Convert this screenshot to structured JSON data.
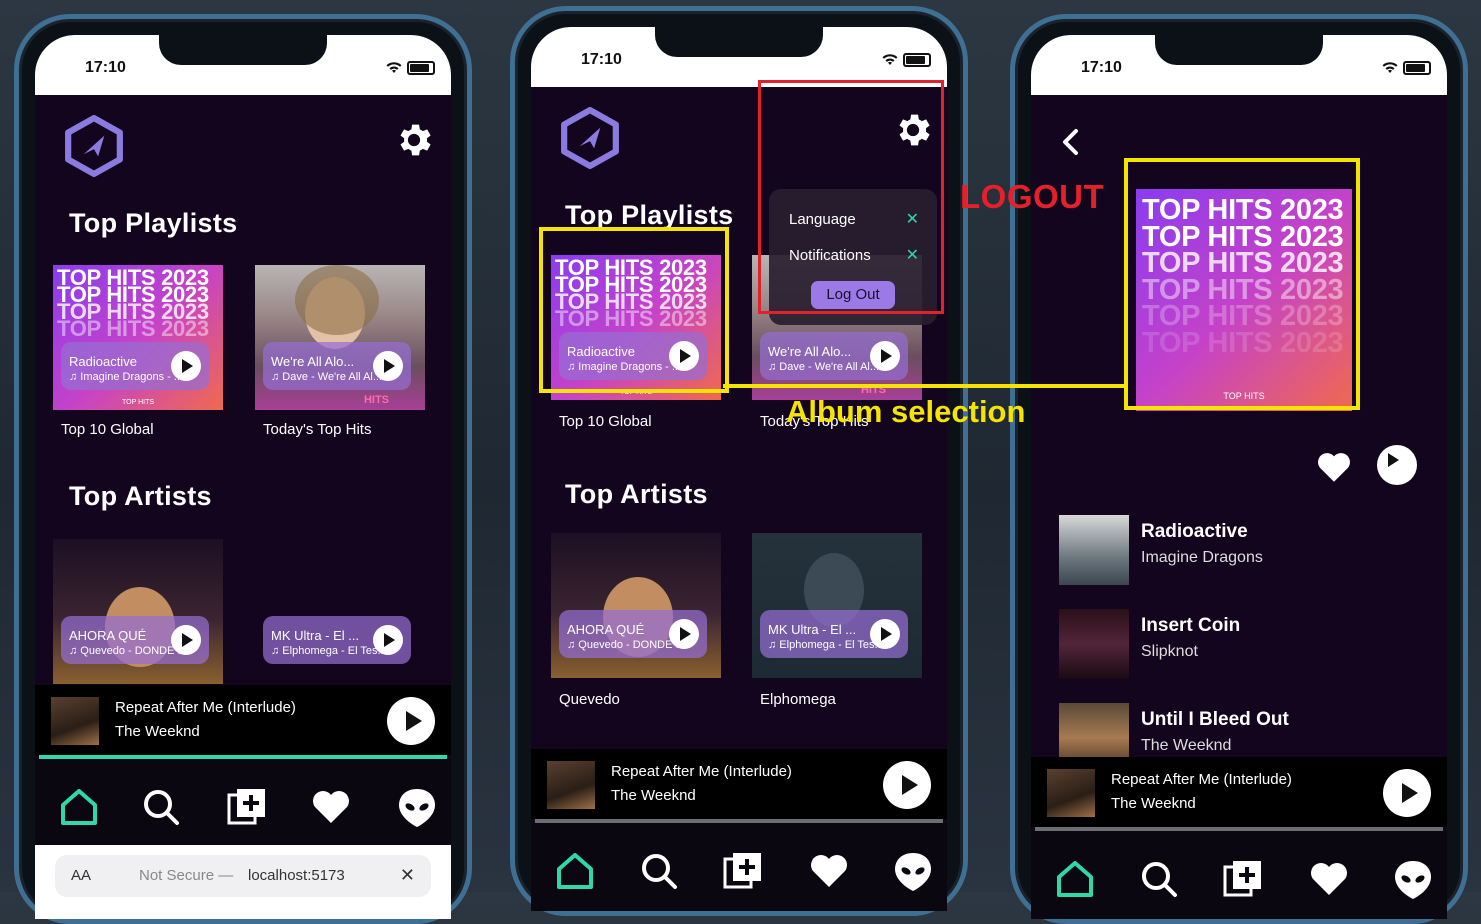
{
  "phones": [
    {
      "time": "17:10",
      "heading_playlists": "Top Playlists",
      "heading_artists": "Top Artists",
      "playlists": [
        {
          "cover_text": "TOP HITS 2023",
          "badge": "TOP HITS",
          "track": "Radioactive",
          "artist": "♫ Imagine Dragons - ...",
          "caption": "Top 10 Global"
        },
        {
          "track": "We're All Alo...",
          "artist": "♫ Dave - We're All Al...",
          "caption": "Today's Top Hits",
          "cover_word": "HITS"
        }
      ],
      "artists": [
        {
          "track": "AHORA QUÉ",
          "artist": "♫ Quevedo - DONDE ...",
          "caption": ""
        },
        {
          "track": "MK Ultra - El ...",
          "artist": "♫ Elphomega - El Tes...",
          "caption": ""
        }
      ],
      "now_playing": {
        "title": "Repeat After Me (Interlude)",
        "artist": "The Weeknd",
        "progress": 1.0
      },
      "safari": {
        "aa": "AA",
        "not_secure": "Not Secure —",
        "url": "localhost:5173",
        "close": "✕"
      }
    },
    {
      "time": "17:10",
      "heading_playlists": "Top Playlists",
      "heading_artists": "Top Artists",
      "menu": {
        "language": "Language",
        "notifications": "Notifications",
        "logout": "Log Out"
      },
      "playlists": [
        {
          "cover_text": "TOP HITS 2023",
          "badge": "TOP HITS",
          "track": "Radioactive",
          "artist": "♫ Imagine Dragons - ...",
          "caption": "Top 10 Global"
        },
        {
          "track": "We're All Alo...",
          "artist": "♫ Dave - We're All Al...",
          "caption": "Today's Top Hits",
          "cover_word": "HITS"
        }
      ],
      "artists": [
        {
          "track": "AHORA QUÉ",
          "artist": "♫ Quevedo - DONDE ...",
          "caption": "Quevedo"
        },
        {
          "track": "MK Ultra - El ...",
          "artist": "♫ Elphomega - El Tes...",
          "caption": "Elphomega"
        }
      ],
      "now_playing": {
        "title": "Repeat After Me (Interlude)",
        "artist": "The Weeknd",
        "progress": 1.0
      }
    },
    {
      "time": "17:10",
      "album": {
        "cover_text": "TOP HITS 2023",
        "badge": "TOP HITS"
      },
      "tracks": [
        {
          "name": "Radioactive",
          "artist": "Imagine Dragons"
        },
        {
          "name": "Insert Coin",
          "artist": "Slipknot"
        },
        {
          "name": "Until I Bleed Out",
          "artist": "The Weeknd"
        }
      ],
      "now_playing": {
        "title": "Repeat After Me (Interlude)",
        "artist": "The Weeknd",
        "progress": 1.0
      }
    }
  ],
  "annotations": {
    "logout": "LOGOUT",
    "album_selection": "Album selection"
  },
  "colors": {
    "accent": "#2fd8a6",
    "background": "#14051f",
    "annotation_red": "#e5202a",
    "annotation_yellow": "#f5e400",
    "pill": "#9b7ae8"
  }
}
